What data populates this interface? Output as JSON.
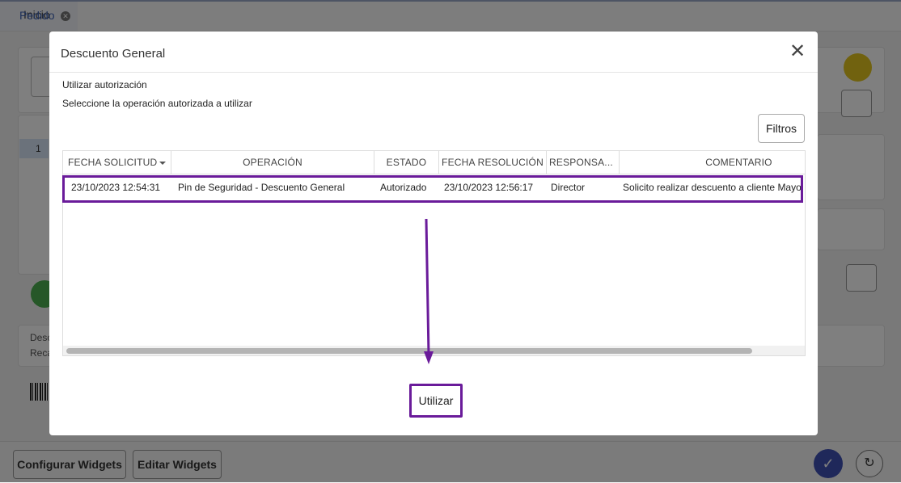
{
  "background": {
    "tabs": [
      {
        "label": "Inicio"
      },
      {
        "label": "Pedido"
      }
    ],
    "side_row_number": "1",
    "side_text_1": "Desc",
    "side_text_2": "Reca",
    "bottom": {
      "configure_widgets": "Configurar Widgets",
      "edit_widgets": "Editar Widgets"
    }
  },
  "modal": {
    "title": "Descuento General",
    "close_icon": "close-icon",
    "subtitle": "Utilizar autorización",
    "instruction": "Seleccione la operación autorizada a utilizar",
    "filters_label": "Filtros",
    "columns": [
      "FECHA SOLICITUD",
      "OPERACIÓN",
      "ESTADO",
      "FECHA RESOLUCIÓN",
      "RESPONSA...",
      "COMENTARIO"
    ],
    "rows": [
      {
        "fecha_solicitud": "23/10/2023 12:54:31",
        "operacion": "Pin de Seguridad - Descuento General",
        "estado": "Autorizado",
        "fecha_resolucion": "23/10/2023 12:56:17",
        "responsable": "Director",
        "comentario": "Solicito realizar descuento a cliente Mayorista"
      }
    ],
    "use_button": "Utilizar"
  },
  "colors": {
    "annotation": "#6a1b9a",
    "primary": "#3f51b5",
    "overlay": "rgba(0,0,0,0.5)"
  }
}
